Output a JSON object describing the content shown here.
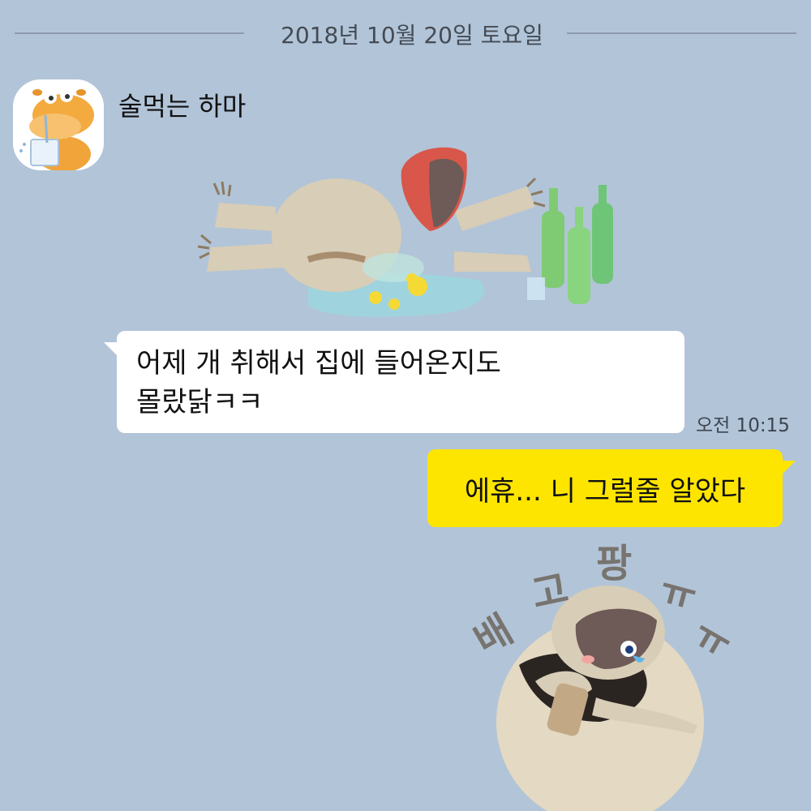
{
  "date_divider": "2018년 10월 20일 토요일",
  "incoming": {
    "sender_name": "술먹는 하마",
    "avatar_icon": "hippo-drinking-avatar",
    "sticker_icon": "drunk-sloth-sticker",
    "message": "어제 개 취해서 집에 들어온지도\n몰랐닭ㅋㅋ",
    "time": "오전 10:15"
  },
  "outgoing": {
    "message": "에휴... 니 그럴줄 알았다",
    "sticker_icon": "crying-sloth-sticker",
    "sticker_caption": [
      "배",
      "고",
      "팡",
      "ㅠ",
      "ㅠ"
    ]
  },
  "colors": {
    "background": "#b2c4d8",
    "incoming_bubble": "#ffffff",
    "outgoing_bubble": "#fee500"
  }
}
